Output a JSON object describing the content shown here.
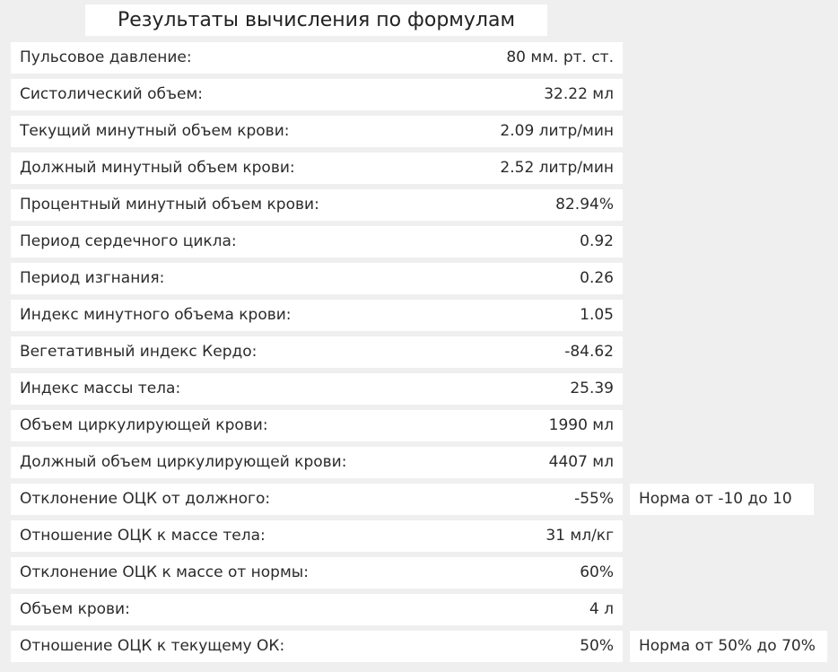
{
  "title": "Результаты вычисления по формулам",
  "rows": [
    {
      "label": "Пульсовое давление:",
      "value": "80 мм. рт. ст.",
      "note": ""
    },
    {
      "label": "Систолический объем:",
      "value": "32.22 мл",
      "note": ""
    },
    {
      "label": "Текущий минутный объем крови:",
      "value": "2.09 литр/мин",
      "note": ""
    },
    {
      "label": "Должный минутный объем крови:",
      "value": "2.52 литр/мин",
      "note": ""
    },
    {
      "label": "Процентный минутный объем крови:",
      "value": "82.94%",
      "note": ""
    },
    {
      "label": "Период сердечного цикла:",
      "value": "0.92",
      "note": ""
    },
    {
      "label": "Период изгнания:",
      "value": "0.26",
      "note": ""
    },
    {
      "label": "Индекс минутного объема крови:",
      "value": "1.05",
      "note": ""
    },
    {
      "label": "Вегетативный индекс Кердо:",
      "value": "-84.62",
      "note": ""
    },
    {
      "label": "Индекс массы тела:",
      "value": "25.39",
      "note": ""
    },
    {
      "label": "Объем циркулирующей крови:",
      "value": "1990 мл",
      "note": ""
    },
    {
      "label": "Должный объем циркулирующей крови:",
      "value": "4407 мл",
      "note": ""
    },
    {
      "label": "Отклонение ОЦК от должного:",
      "value": "-55%",
      "note": "Норма от -10 до 10"
    },
    {
      "label": "Отношение ОЦК к массе тела:",
      "value": "31 мл/кг",
      "note": ""
    },
    {
      "label": "Отклонение ОЦК к массе от нормы:",
      "value": "60%",
      "note": ""
    },
    {
      "label": "Объем крови:",
      "value": "4 л",
      "note": ""
    },
    {
      "label": "Отношение ОЦК к текущему ОК:",
      "value": "50%",
      "note": "Норма от 50% до 70%"
    }
  ]
}
